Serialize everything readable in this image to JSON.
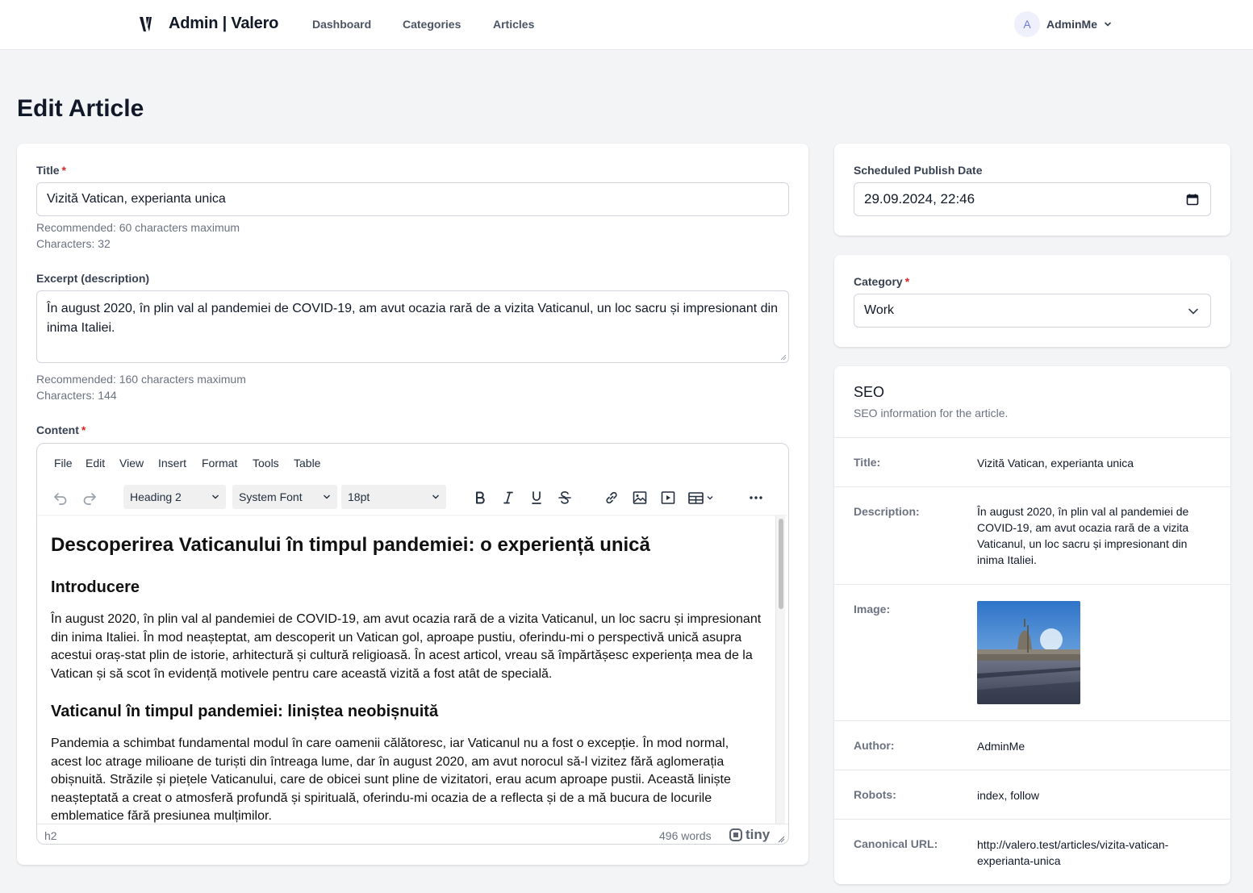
{
  "app": {
    "brand": "Admin | Valero",
    "nav": [
      "Dashboard",
      "Categories",
      "Articles"
    ],
    "user": {
      "initial": "A",
      "name": "AdminMe"
    }
  },
  "page": {
    "title": "Edit Article"
  },
  "form": {
    "title": {
      "label": "Title",
      "required_mark": "*",
      "value": "Vizită Vatican, experianta unica",
      "hint_recommended": "Recommended: 60 characters maximum",
      "hint_count": "Characters: 32"
    },
    "excerpt": {
      "label": "Excerpt (description)",
      "value": "În august 2020, în plin val al pandemiei de COVID-19, am avut ocazia rară de a vizita Vaticanul, un loc sacru și impresionant din inima Italiei.",
      "hint_recommended": "Recommended: 160 characters maximum",
      "hint_count": "Characters: 144"
    },
    "content": {
      "label": "Content",
      "required_mark": "*",
      "menubar": [
        "File",
        "Edit",
        "View",
        "Insert",
        "Format",
        "Tools",
        "Table"
      ],
      "toolbar": {
        "block_format": "Heading 2",
        "font_family": "System Font",
        "font_size": "18pt",
        "icons": [
          "undo-icon",
          "redo-icon",
          "bold-icon",
          "italic-icon",
          "underline-icon",
          "strikethrough-icon",
          "link-icon",
          "image-icon",
          "media-icon",
          "table-icon",
          "more-icon"
        ]
      },
      "body": {
        "h1": "Descoperirea Vaticanului în timpul pandemiei: o experiență unică",
        "h2_intro": "Introducere",
        "p1": "În august 2020, în plin val al pandemiei de COVID-19, am avut ocazia rară de a vizita Vaticanul, un loc sacru și impresionant din inima Italiei. În mod neașteptat, am descoperit un Vatican gol, aproape pustiu, oferindu-mi o perspectivă unică asupra acestui oraș-stat plin de istorie, arhitectură și cultură religioasă. În acest articol, vreau să împărtășesc experiența mea de la Vatican și să scot în evidență motivele pentru care această vizită a fost atât de specială.",
        "h2_section": "Vaticanul în timpul pandemiei: liniștea neobișnuită",
        "p2": "Pandemia a schimbat fundamental modul în care oamenii călătoresc, iar Vaticanul nu a fost o excepție. În mod normal, acest loc atrage milioane de turiști din întreaga lume, dar în august 2020, am avut norocul să-l vizitez fără aglomerația obișnuită. Străzile și piețele Vaticanului, care de obicei sunt pline de vizitatori, erau acum aproape pustii. Această liniște neașteptată a creat o atmosferă profundă și spirituală, oferindu-mi ocazia de a reflecta și de a mă bucura de locurile emblematice fără presiunea mulțimilor."
      },
      "status": {
        "path": "h2",
        "words": "496 words",
        "brand": "tiny"
      }
    }
  },
  "schedule": {
    "label": "Scheduled Publish Date",
    "value": "29.09.2024, 22:46"
  },
  "category": {
    "label": "Category",
    "required_mark": "*",
    "value": "Work"
  },
  "seo": {
    "title": "SEO",
    "subtitle": "SEO information for the article.",
    "rows": {
      "title": {
        "key": "Title:",
        "value": "Vizită Vatican, experianta unica"
      },
      "description": {
        "key": "Description:",
        "value": "În august 2020, în plin val al pandemiei de COVID-19, am avut ocazia rară de a vizita Vaticanul, un loc sacru și impresionant din inima Italiei."
      },
      "image": {
        "key": "Image:"
      },
      "author": {
        "key": "Author:",
        "value": "AdminMe"
      },
      "robots": {
        "key": "Robots:",
        "value": "index, follow"
      },
      "canonical": {
        "key": "Canonical URL:",
        "value": "http://valero.test/articles/vizita-vatican-experianta-unica"
      }
    }
  },
  "colors": {
    "background": "#f3f4f6",
    "card": "#ffffff",
    "required": "#dc2626",
    "avatar_bg": "#eef0fb",
    "avatar_fg": "#6f7bd1"
  }
}
